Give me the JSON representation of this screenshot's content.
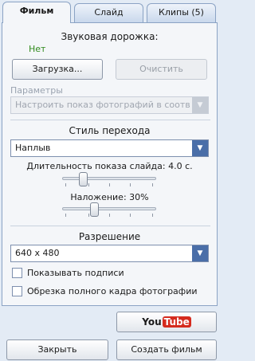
{
  "tabs": [
    {
      "label": "Фильм",
      "active": true
    },
    {
      "label": "Слайд",
      "active": false
    },
    {
      "label": "Клипы (5)",
      "active": false
    }
  ],
  "audio": {
    "title": "Звуковая дорожка:",
    "status": "Нет",
    "load_button": "Загрузка...",
    "clear_button": "Очистить"
  },
  "params": {
    "label": "Параметры",
    "selected": "Настроить показ фотографий в соответствии с..."
  },
  "transition": {
    "title": "Стиль перехода",
    "selected": "Наплыв",
    "duration_label": "Длительность показа слайда: 4.0 с.",
    "duration_value": 4.0,
    "duration_fraction": 0.2,
    "overlap_label": "Наложение: 30%",
    "overlap_value": 30,
    "overlap_fraction": 0.33
  },
  "resolution": {
    "title": "Разрешение",
    "selected": "640 x 480"
  },
  "options": {
    "show_captions": "Показывать подписи",
    "show_captions_checked": false,
    "crop_full_frame": "Обрезка полного кадра фотографии",
    "crop_full_frame_checked": false
  },
  "youtube": {
    "you": "You",
    "tube": "Tube"
  },
  "footer": {
    "close_button": "Закрыть",
    "create_button": "Создать фильм"
  },
  "colors": {
    "accent": "#4a6ea8",
    "status_green": "#2f8a1c",
    "background": "#e3ebf5"
  }
}
